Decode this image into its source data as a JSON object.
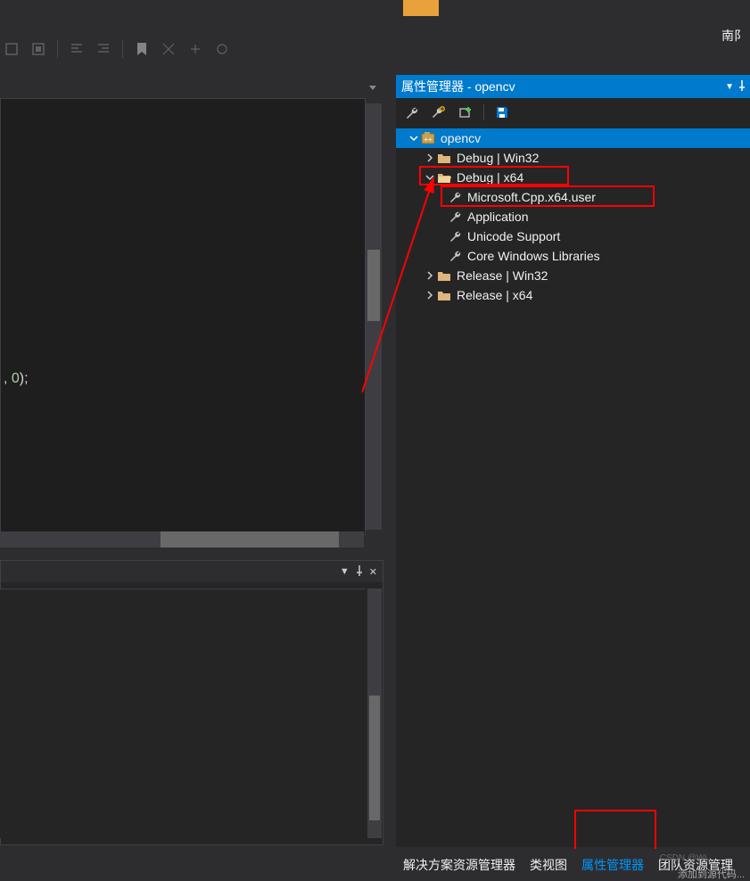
{
  "top_right": "南阝",
  "code_snippet": ", 0);",
  "panel": {
    "title": "属性管理器 - opencv",
    "project": "opencv",
    "configs": {
      "debug_win32": "Debug | Win32",
      "debug_x64": "Debug | x64",
      "release_win32": "Release | Win32",
      "release_x64": "Release | x64"
    },
    "sheets": {
      "user": "Microsoft.Cpp.x64.user",
      "application": "Application",
      "unicode": "Unicode Support",
      "core": "Core Windows Libraries"
    }
  },
  "tabs": {
    "solution_explorer": "解决方案资源管理器",
    "class_view": "类视图",
    "property_manager": "属性管理器",
    "team_explorer": "团队资源管理"
  },
  "watermark": "CSDN @Wi...",
  "bottom_cut": "添加到源代码..."
}
